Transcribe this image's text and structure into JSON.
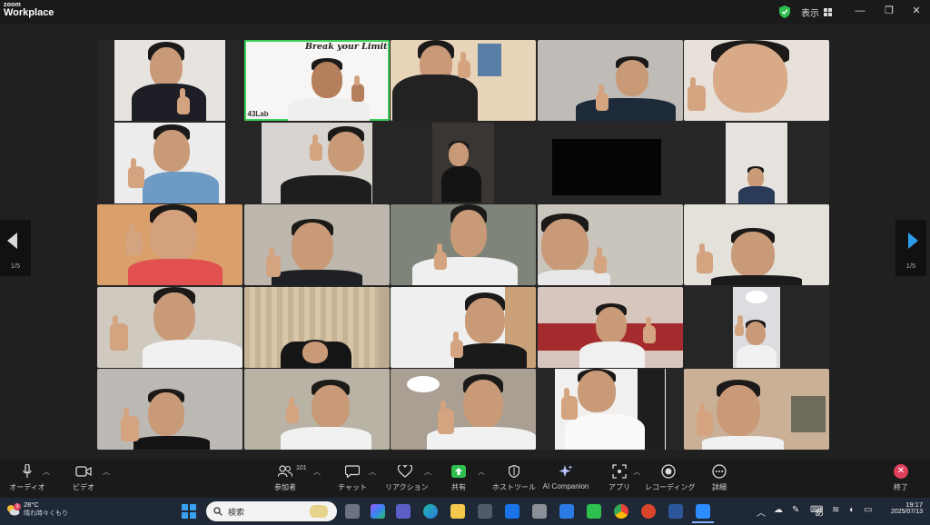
{
  "titlebar": {
    "brand_top": "zoom",
    "brand_bottom": "Workplace",
    "view_label": "表示"
  },
  "gallery": {
    "banner_text": "Break your Limit",
    "logo_text": "43Lab"
  },
  "nav": {
    "left_page": "1/5",
    "right_page": "1/5"
  },
  "toolbar": {
    "audio_label": "オーディオ",
    "video_label": "ビデオ",
    "participants_label": "参加者",
    "participants_count": "101",
    "chat_label": "チャット",
    "reactions_label": "リアクション",
    "share_label": "共有",
    "host_tools_label": "ホストツール",
    "ai_label": "AI Companion",
    "apps_label": "アプリ",
    "record_label": "レコーディング",
    "more_label": "詳細",
    "end_label": "終了"
  },
  "taskbar": {
    "weather_temp": "28°C",
    "weather_desc": "晴れ時々くもり",
    "weather_badge": "3",
    "search_placeholder": "検索",
    "ime": "あ",
    "time": "19:17",
    "date": "2025/07/13"
  },
  "colors": {
    "active_speaker": "#3ecf5b",
    "next_arrow": "#2b9be8",
    "end_button": "#e0405b"
  }
}
